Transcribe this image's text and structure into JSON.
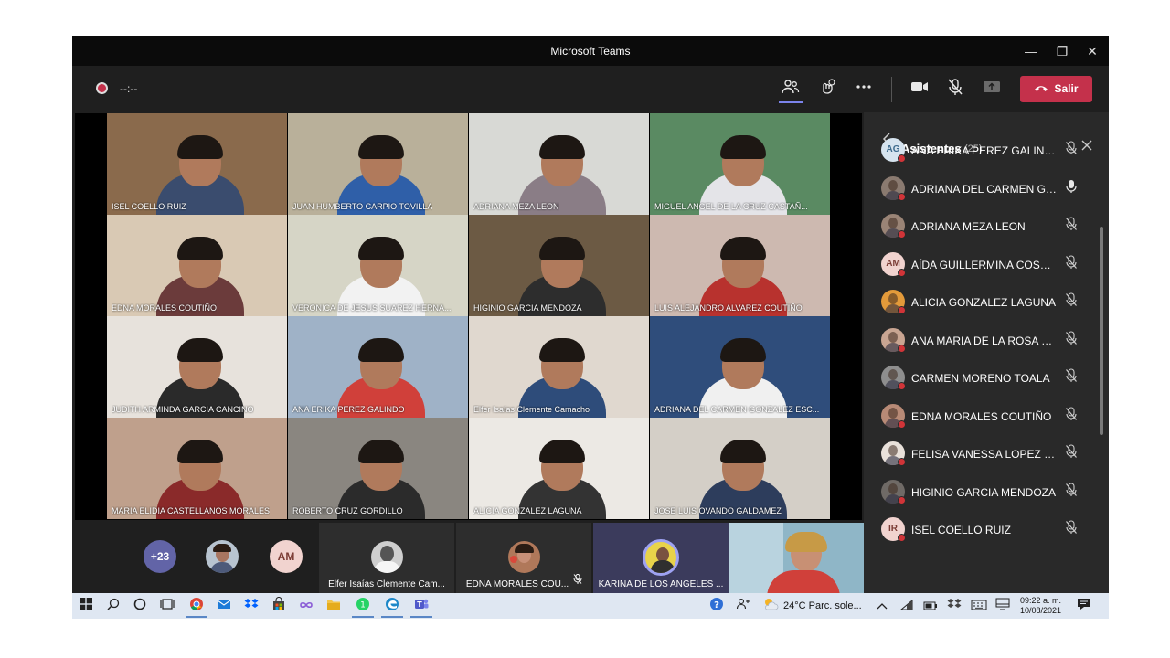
{
  "window": {
    "title": "Microsoft Teams",
    "controls": [
      "—",
      "❐",
      "✕"
    ]
  },
  "toolbar": {
    "timer": "--:--",
    "leave_label": "Salir",
    "icons": [
      "people-icon",
      "reactions-icon",
      "more-icon",
      "camera-icon",
      "mic-muted-icon",
      "share-tray-icon"
    ]
  },
  "grid": [
    {
      "name": "ISEL COELLO  RUIZ",
      "bg": "#8a6a4c",
      "shirt": "#3a4c6e"
    },
    {
      "name": "JUAN HUMBERTO CARPIO TOVILLA",
      "bg": "#b9b09a",
      "shirt": "#2f5fa8"
    },
    {
      "name": "ADRIANA MEZA LEON",
      "bg": "#d8d9d5",
      "shirt": "#8a7d86"
    },
    {
      "name": "MIGUEL ANGEL DE LA CRUZ  CASTAÑ...",
      "bg": "#5a8a62",
      "shirt": "#e4e4e8"
    },
    {
      "name": "EDNA MORALES  COUTIÑO",
      "bg": "#d9c9b4",
      "shirt": "#6b3b3b"
    },
    {
      "name": "VERONICA  DE JESUS SUAREZ  HERNA...",
      "bg": "#d6d5c6",
      "shirt": "#f2f2f2"
    },
    {
      "name": "HIGINIO GARCIA  MENDOZA",
      "bg": "#6c5a44",
      "shirt": "#2d2d2d"
    },
    {
      "name": "LUIS ALEJANDRO ALVAREZ COUTIÑO",
      "bg": "#cdb9b0",
      "shirt": "#b8322e"
    },
    {
      "name": "JUDITH ARMINDA GARCIA CANCINO",
      "bg": "#e7e2dc",
      "shirt": "#2a2a2a"
    },
    {
      "name": "ANA ERIKA PEREZ  GALINDO",
      "bg": "#9fb2c7",
      "shirt": "#d0403a"
    },
    {
      "name": "Elfer Isaías Clemente Camacho",
      "bg": "#e0d8cf",
      "shirt": "#2e4c7a"
    },
    {
      "name": "ADRIANA DEL CARMEN GONZALEZ ESC...",
      "bg": "#2f4d7b",
      "shirt": "#f0f0f0"
    },
    {
      "name": "MARIA ELIDIA CASTELLANOS MORALES",
      "bg": "#bfa08c",
      "shirt": "#8a2a2a"
    },
    {
      "name": "ROBERTO CRUZ  GORDILLO",
      "bg": "#8a8680",
      "shirt": "#2b2b2b"
    },
    {
      "name": "ALICIA GONZALEZ  LAGUNA",
      "bg": "#ece9e4",
      "shirt": "#333"
    },
    {
      "name": "JOSE LUIS OVANDO GALDAMEZ",
      "bg": "#d4cfc7",
      "shirt": "#2d3d5c"
    }
  ],
  "strip": {
    "more_count": "+23",
    "initials": "AM",
    "tiles": [
      {
        "label": "Elfer Isaías Clemente Cam..."
      },
      {
        "label": "EDNA MORALES COU..."
      },
      {
        "label": "KARINA DE LOS ANGELES ..."
      }
    ]
  },
  "panel": {
    "title": "Asistentes",
    "count": "(25)",
    "attendees": [
      {
        "name": "ANA ERIKA PEREZ GALINDO",
        "initials": "AG",
        "avbg": "#d6e4ef",
        "avfg": "#3c6a8c",
        "mic": "muted"
      },
      {
        "name": "ADRIANA DEL CARMEN GON...",
        "initials": "",
        "avbg": "#8a7a70",
        "avfg": "#fff",
        "mic": "on"
      },
      {
        "name": "ADRIANA MEZA LEON",
        "initials": "",
        "avbg": "#9a8476",
        "avfg": "#fff",
        "mic": "muted"
      },
      {
        "name": "AÍDA GUILLERMINA COSSIO ...",
        "initials": "AM",
        "avbg": "#f1d3cf",
        "avfg": "#7a3b34",
        "mic": "muted"
      },
      {
        "name": "ALICIA GONZALEZ LAGUNA",
        "initials": "",
        "avbg": "#e39a3a",
        "avfg": "#fff",
        "mic": "muted"
      },
      {
        "name": "ANA MARIA DE LA ROSA FLO...",
        "initials": "",
        "avbg": "#c9a592",
        "avfg": "#fff",
        "mic": "muted"
      },
      {
        "name": "CARMEN MORENO TOALA",
        "initials": "",
        "avbg": "#8e8e8e",
        "avfg": "#fff",
        "mic": "muted"
      },
      {
        "name": "EDNA MORALES COUTIÑO",
        "initials": "",
        "avbg": "#b88a76",
        "avfg": "#fff",
        "mic": "muted"
      },
      {
        "name": "FELISA VANESSA LOPEZ PINE...",
        "initials": "",
        "avbg": "#e9e1da",
        "avfg": "#555",
        "mic": "muted"
      },
      {
        "name": "HIGINIO GARCIA MENDOZA",
        "initials": "",
        "avbg": "#6f6a66",
        "avfg": "#fff",
        "mic": "muted"
      },
      {
        "name": "ISEL COELLO RUIZ",
        "initials": "IR",
        "avbg": "#f1d3cf",
        "avfg": "#7a3b34",
        "mic": "muted"
      }
    ]
  },
  "taskbar": {
    "weather": "24°C  Parc. sole...",
    "time": "09:22 a. m.",
    "date": "10/08/2021"
  },
  "colors": {
    "accent": "#7b83eb",
    "leave": "#c4314b",
    "panel": "#292929"
  }
}
